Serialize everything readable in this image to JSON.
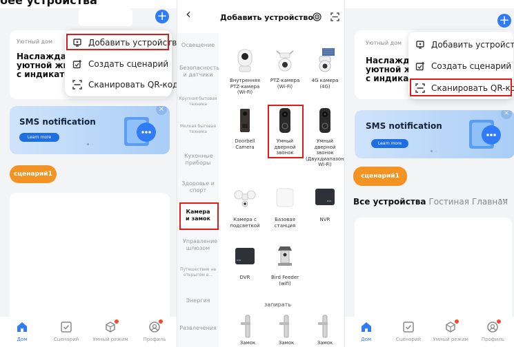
{
  "screen1": {
    "cut_title": "бее устройства",
    "home_name": "Уютный дом",
    "headline_lines": [
      "Наслаждайт",
      "уютной жиз",
      "с индикатор"
    ],
    "menu": [
      {
        "label": "Добавить устройство",
        "icon": "add-device-icon"
      },
      {
        "label": "Создать сценарий",
        "icon": "create-scenario-icon"
      },
      {
        "label": "Сканировать QR-код",
        "icon": "scan-icon"
      }
    ],
    "highlighted_item": 0,
    "banner": {
      "title": "SMS notification",
      "button": "Learn more"
    },
    "scene_chip": "сценарий1"
  },
  "tabbar": [
    {
      "label": "Дом",
      "icon": "home-icon",
      "active": true
    },
    {
      "label": "Сценарий",
      "icon": "checkbox-icon",
      "active": false
    },
    {
      "label": "Умный режим",
      "icon": "smart-mode-icon",
      "active": false
    },
    {
      "label": "Профиль",
      "icon": "profile-icon",
      "active": false
    }
  ],
  "screen2": {
    "title": "Добавить устройство",
    "categories": [
      "Освещение",
      "Безопасность и датчики",
      "Крупная бытовая техника",
      "Мелкая бытовая техника",
      "Кухонные приборы",
      "Здоровье и спорт",
      "Камера и замок",
      "Управление шлюзом",
      "Путешествие на открытом в...",
      "Энергия",
      "Развлечения"
    ],
    "selected_category": 6,
    "devices": [
      "Внутренняя PTZ-камера (Wi-Fi)",
      "PTZ-камера (Wi-Fi)",
      "4G камера (4G)",
      "Doorbell Camera",
      "Умный дверной звонок",
      "Умный дверной звонок (Двухдиапазонный Wi-Fi)",
      "Камера с подсветкой",
      "Базовая станция",
      "NVR",
      "DVR",
      "Bird Feeder (wifi)"
    ],
    "highlighted_device": 4,
    "section_lock": "запирать",
    "locks": [
      "Замок",
      "Замок",
      "Замок"
    ],
    "nvr_tag": "NVR",
    "dvr_tag": "DVR"
  },
  "screen3": {
    "home_name": "Уютный дом",
    "headline_lines": [
      "Наслаждайт",
      "уютной жизн",
      "с индикатор"
    ],
    "menu": [
      {
        "label": "Добавить устройство",
        "icon": "add-device-icon"
      },
      {
        "label": "Создать сценарий",
        "icon": "create-scenario-icon"
      },
      {
        "label": "Сканировать QR-код",
        "icon": "scan-icon"
      }
    ],
    "highlighted_item": 2,
    "banner": {
      "title": "SMS notification",
      "button": "Learn more"
    },
    "scene_chip": "сценарий1",
    "filters": {
      "all": "Все устройства",
      "living": "Гостиная",
      "main": "Главная",
      "more": "···"
    }
  },
  "colors": {
    "accent": "#2f7cf6",
    "orange": "#f39323",
    "highlight": "#e01919"
  }
}
